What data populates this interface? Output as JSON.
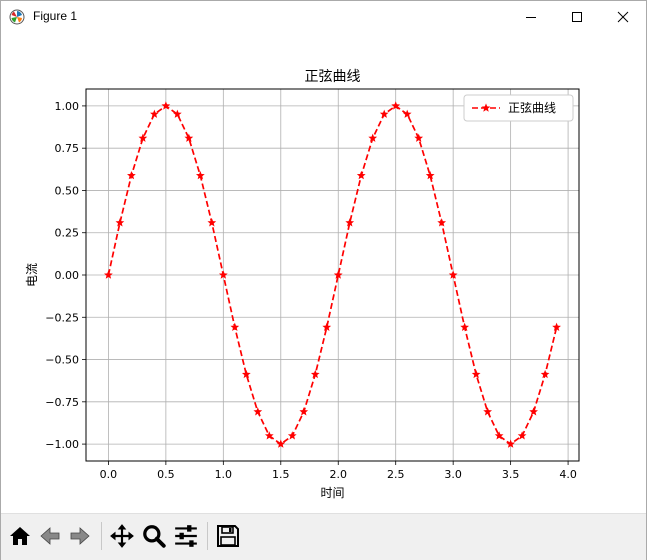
{
  "window": {
    "title": "Figure 1",
    "icon": "matplotlib-icon",
    "controls": [
      "minimize-icon",
      "maximize-icon",
      "close-icon"
    ]
  },
  "toolbar": {
    "buttons": [
      {
        "name": "home-button",
        "icon": "home-icon",
        "tooltip": "Reset original view"
      },
      {
        "name": "back-button",
        "icon": "back-arrow-icon",
        "tooltip": "Back to previous view"
      },
      {
        "name": "forward-button",
        "icon": "forward-arrow-icon",
        "tooltip": "Forward to next view"
      },
      {
        "name": "pan-button",
        "icon": "move-icon",
        "tooltip": "Pan axes"
      },
      {
        "name": "zoom-button",
        "icon": "magnifier-icon",
        "tooltip": "Zoom to rectangle"
      },
      {
        "name": "configure-button",
        "icon": "sliders-icon",
        "tooltip": "Configure subplots"
      },
      {
        "name": "save-button",
        "icon": "floppy-disk-icon",
        "tooltip": "Save the figure"
      }
    ]
  },
  "chart_data": {
    "type": "line",
    "title": "正弦曲线",
    "xlabel": "时间",
    "ylabel": "电流",
    "xlim": [
      -0.195,
      4.095
    ],
    "ylim": [
      -1.1,
      1.1
    ],
    "xticks": [
      0.0,
      0.5,
      1.0,
      1.5,
      2.0,
      2.5,
      3.0,
      3.5,
      4.0
    ],
    "xtick_labels": [
      "0.0",
      "0.5",
      "1.0",
      "1.5",
      "2.0",
      "2.5",
      "3.0",
      "3.5",
      "4.0"
    ],
    "yticks": [
      1.0,
      0.75,
      0.5,
      0.25,
      0.0,
      -0.25,
      -0.5,
      -0.75,
      -1.0
    ],
    "ytick_labels": [
      "1.00",
      "0.75",
      "0.50",
      "0.25",
      "0.00",
      "−0.25",
      "−0.50",
      "−0.75",
      "−1.00"
    ],
    "grid": true,
    "legend": "upper-right",
    "series": [
      {
        "name": "正弦曲线",
        "color": "#ff0000",
        "linestyle": "dashed",
        "marker": "star",
        "x": [
          0.0,
          0.1,
          0.2,
          0.3,
          0.4,
          0.5,
          0.6,
          0.7,
          0.8,
          0.9,
          1.0,
          1.1,
          1.2,
          1.3,
          1.4,
          1.5,
          1.6,
          1.7,
          1.8,
          1.9,
          2.0,
          2.1,
          2.2,
          2.3,
          2.4,
          2.5,
          2.6,
          2.7,
          2.8,
          2.9,
          3.0,
          3.1,
          3.2,
          3.3,
          3.4,
          3.5,
          3.6,
          3.7,
          3.8,
          3.9
        ],
        "y": [
          0.0,
          0.309,
          0.588,
          0.809,
          0.951,
          1.0,
          0.951,
          0.809,
          0.588,
          0.309,
          0.0,
          -0.309,
          -0.588,
          -0.809,
          -0.951,
          -1.0,
          -0.951,
          -0.809,
          -0.588,
          -0.309,
          0.0,
          0.309,
          0.588,
          0.809,
          0.951,
          1.0,
          0.951,
          0.809,
          0.588,
          0.309,
          0.0,
          -0.309,
          -0.588,
          -0.809,
          -0.951,
          -1.0,
          -0.951,
          -0.809,
          -0.588,
          -0.309
        ]
      }
    ]
  }
}
